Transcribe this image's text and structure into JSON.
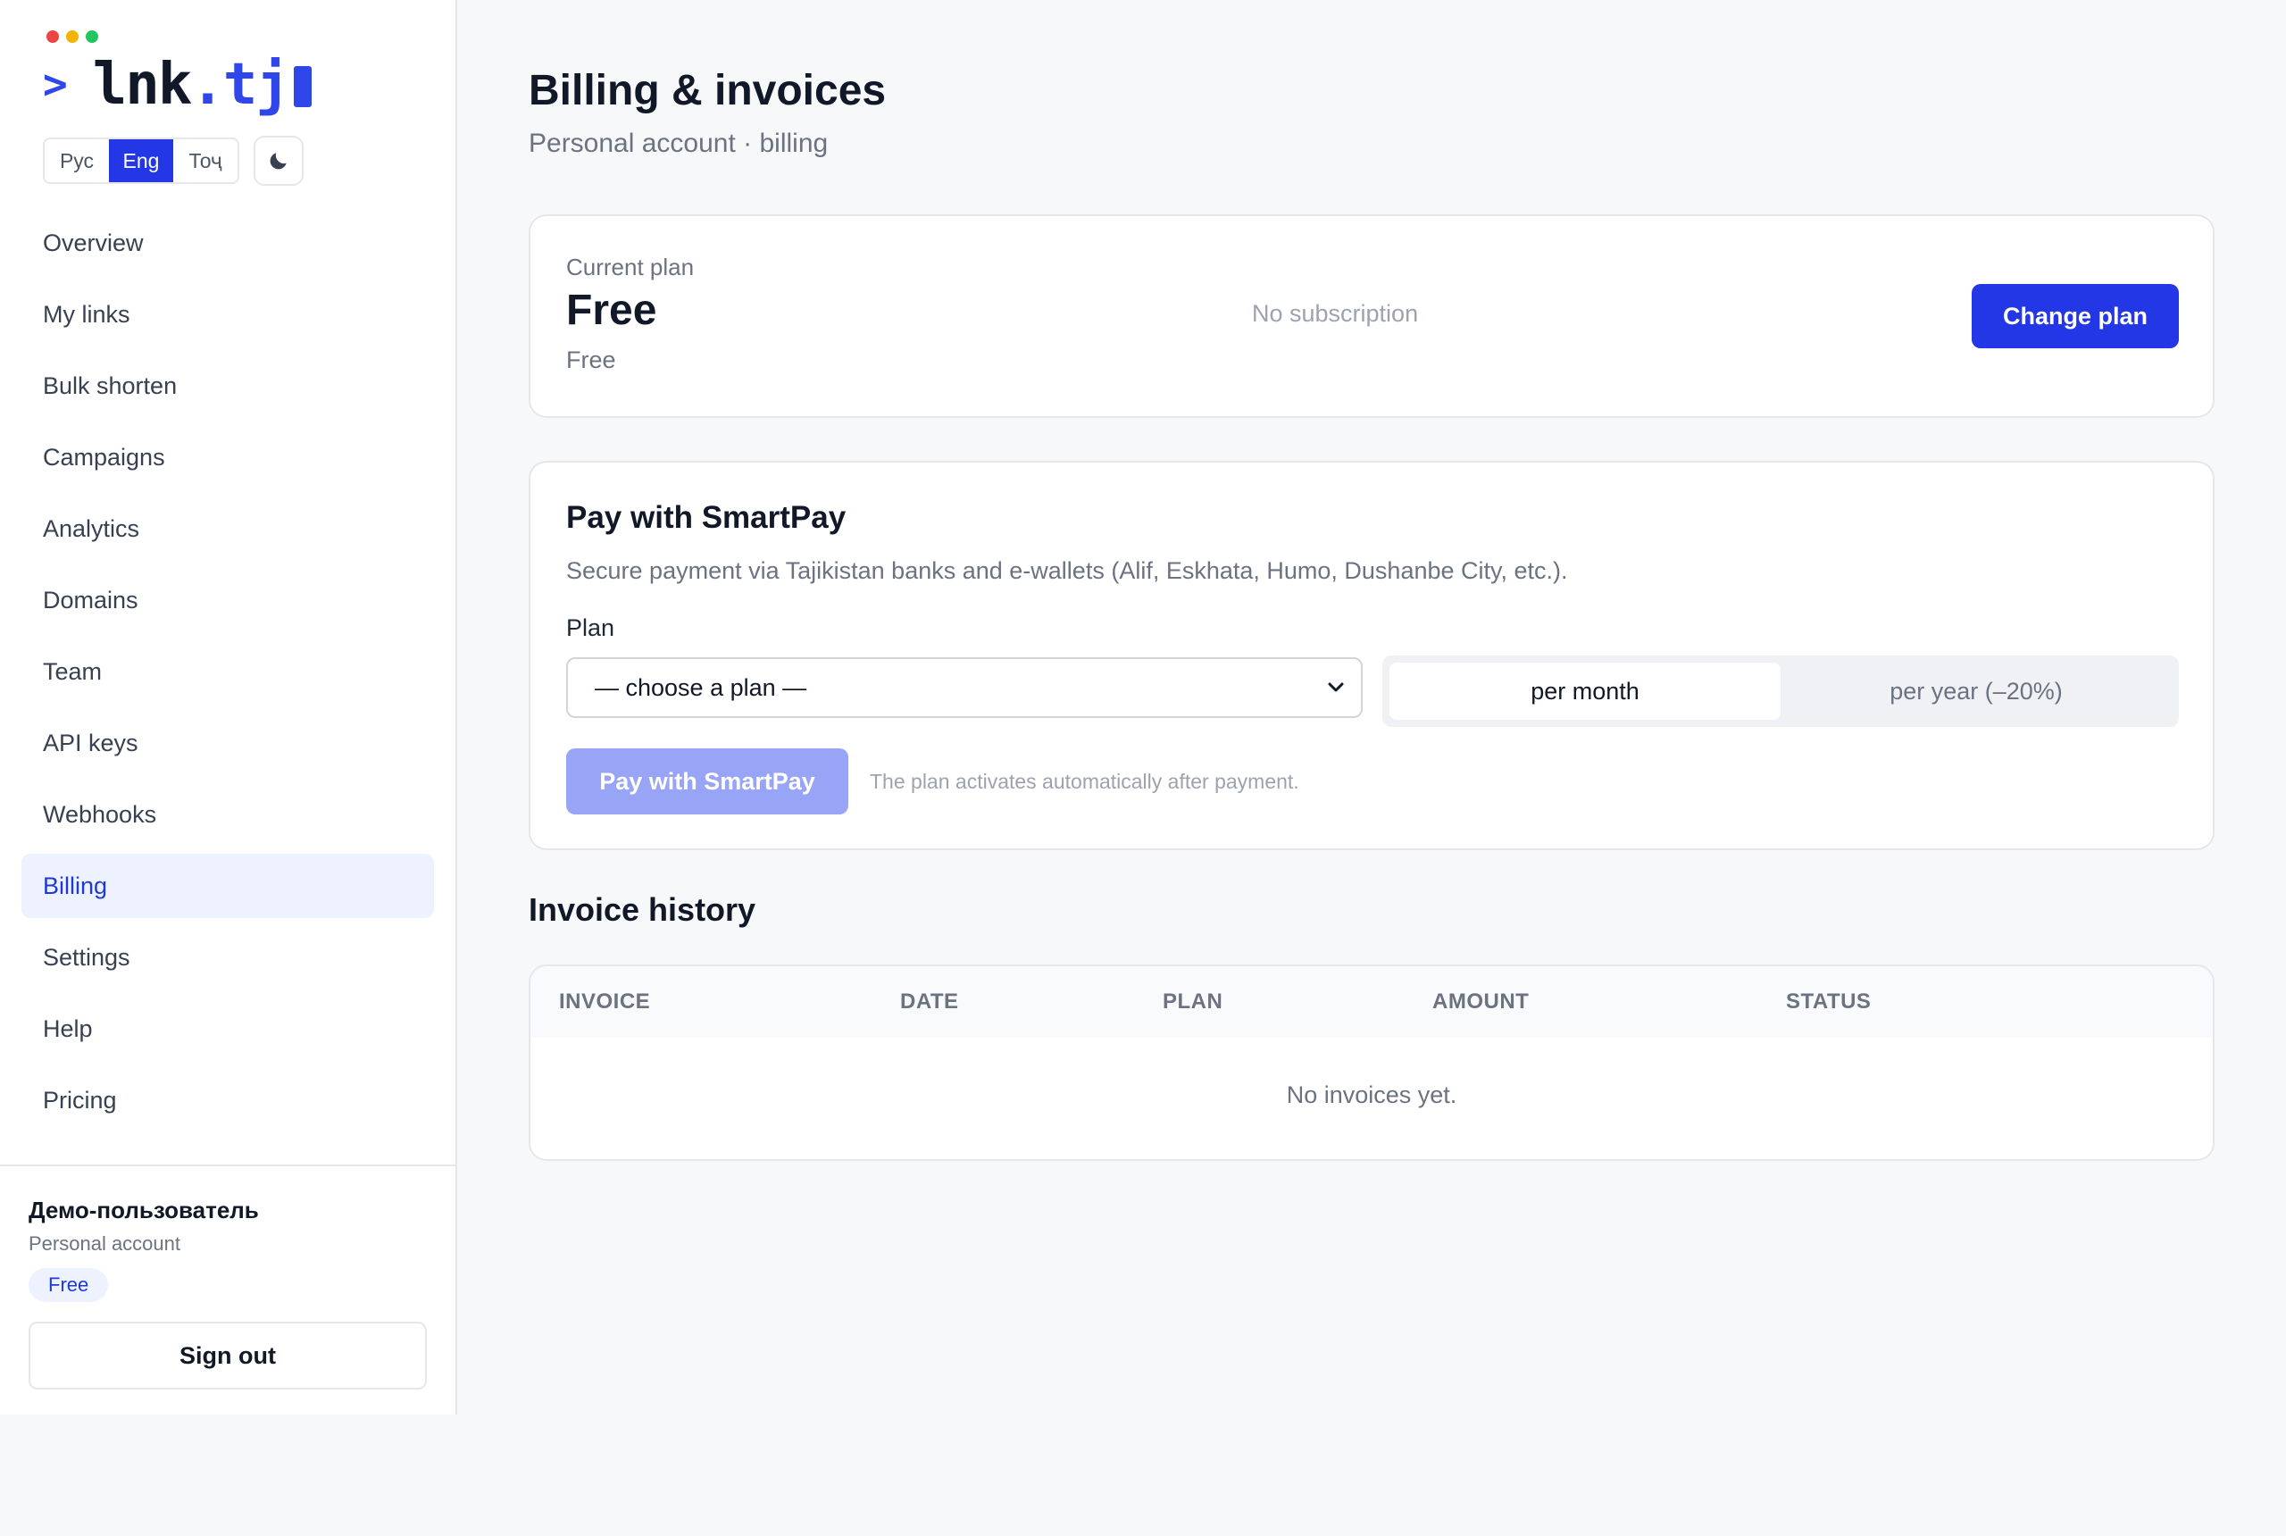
{
  "colors": {
    "accent": "#2337e6",
    "accent_soft": "#eef2ff",
    "disabled_button": "#98a4f5",
    "traffic_red": "#ef4444",
    "traffic_yellow": "#f5b301",
    "traffic_green": "#22c55e"
  },
  "logo": {
    "prompt": ">",
    "name": "lnk",
    "dot": ".",
    "tld": "tj"
  },
  "languages": [
    "Рус",
    "Eng",
    "Тоҷ"
  ],
  "active_language": "Eng",
  "theme_toggle_icon": "moon-icon",
  "nav": {
    "items": [
      {
        "label": "Overview"
      },
      {
        "label": "My links"
      },
      {
        "label": "Bulk shorten"
      },
      {
        "label": "Campaigns"
      },
      {
        "label": "Analytics"
      },
      {
        "label": "Domains"
      },
      {
        "label": "Team"
      },
      {
        "label": "API keys"
      },
      {
        "label": "Webhooks"
      },
      {
        "label": "Billing"
      },
      {
        "label": "Settings"
      },
      {
        "label": "Help"
      },
      {
        "label": "Pricing"
      }
    ],
    "active": "Billing"
  },
  "user": {
    "name": "Демо-пользователь",
    "account": "Personal account",
    "plan_badge": "Free",
    "sign_out": "Sign out"
  },
  "page": {
    "title": "Billing & invoices",
    "subtitle": "Personal account · billing"
  },
  "current_plan": {
    "label": "Current plan",
    "name": "Free",
    "sub": "Free",
    "status": "No subscription",
    "change_button": "Change plan"
  },
  "smartpay": {
    "title": "Pay with SmartPay",
    "description": "Secure payment via Tajikistan banks and e-wallets (Alif, Eskhata, Humo, Dushanbe City, etc.).",
    "plan_label": "Plan",
    "plan_select_value": "— choose a plan —",
    "period_monthly": "per month",
    "period_yearly": "per year (–20%)",
    "selected_period": "per month",
    "pay_button": "Pay with SmartPay",
    "hint": "The plan activates automatically after payment."
  },
  "invoices": {
    "title": "Invoice history",
    "columns": [
      "INVOICE",
      "DATE",
      "PLAN",
      "AMOUNT",
      "STATUS"
    ],
    "empty": "No invoices yet."
  }
}
